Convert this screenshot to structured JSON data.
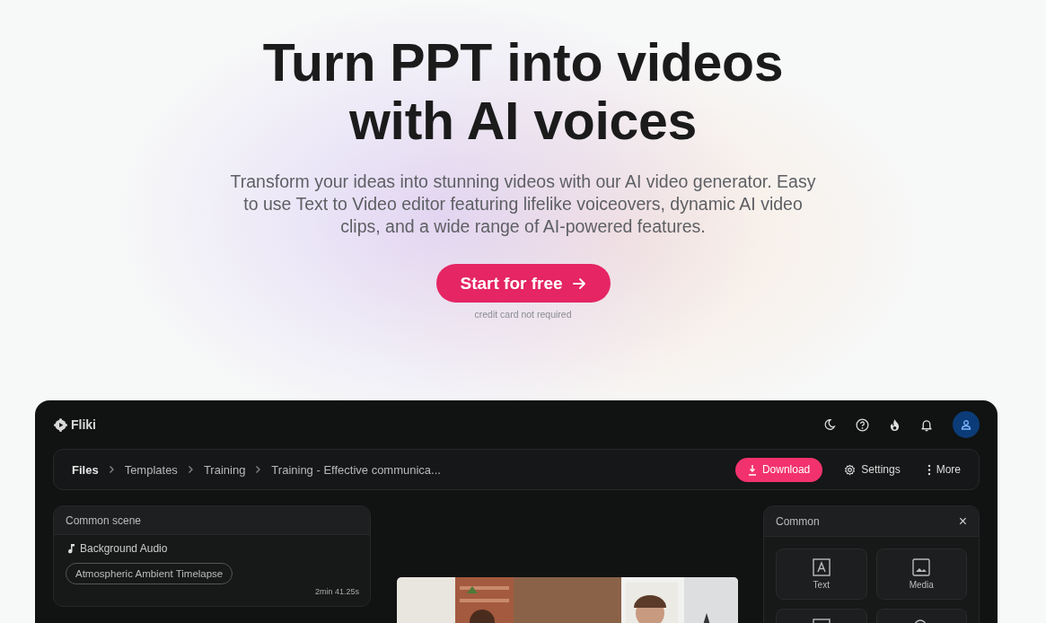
{
  "hero": {
    "title_lines": [
      "Turn PPT into videos",
      "with AI voices"
    ],
    "subtitle": "Transform your ideas into stunning videos with our AI video generator. Easy to use Text to Video editor featuring lifelike voiceovers, dynamic AI video clips, and a wide range of AI-powered features.",
    "cta": "Start for free",
    "cta_note": "credit card not required"
  },
  "app": {
    "logo": "Fliki",
    "breadcrumbs": [
      "Files",
      "Templates",
      "Training",
      "Training - Effective communica..."
    ],
    "actions": [
      {
        "kind": "download",
        "label": "Download"
      },
      {
        "kind": "settings",
        "label": "Settings"
      },
      {
        "kind": "more",
        "label": "More"
      }
    ],
    "scene_panel": {
      "title": "Common scene",
      "audio_label": "Background Audio",
      "track": "Atmospheric Ambient Timelapse",
      "duration": "2min 41.25s"
    },
    "common_panel": {
      "title": "Common",
      "close": "×",
      "tiles": [
        {
          "kind": "text",
          "label": "Text"
        },
        {
          "kind": "media",
          "label": "Media"
        },
        {
          "kind": "layout"
        },
        {
          "kind": "search"
        }
      ]
    }
  }
}
